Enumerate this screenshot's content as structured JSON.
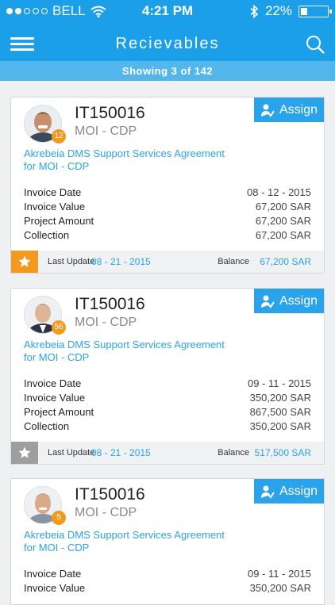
{
  "status_bar": {
    "carrier": "BELL",
    "time": "4:21 PM",
    "battery": "22%"
  },
  "nav": {
    "title": "Recievables"
  },
  "subheader": {
    "showing": "Showing 3 of 142"
  },
  "colors": {
    "primary": "#1a9fe8",
    "accent_orange": "#f39a1e",
    "link_blue": "#2aa3ea"
  },
  "cards": [
    {
      "code": "IT150016",
      "dept": "MOI - CDP",
      "badge": "12",
      "assign": "Assign",
      "description": "Akrebeia DMS Support Services Agreement for MOI - CDP",
      "rows": [
        {
          "label": "Invoice Date",
          "value": "08 - 12 - 2015"
        },
        {
          "label": "Invoice Value",
          "value": "67,200 SAR"
        },
        {
          "label": "Project Amount",
          "value": "67,200 SAR"
        },
        {
          "label": "Collection",
          "value": "67,200 SAR"
        }
      ],
      "last_update_label": "Last Update",
      "last_update": "08 - 21 - 2015",
      "balance_label": "Balance",
      "balance": "67,200 SAR",
      "starred": true
    },
    {
      "code": "IT150016",
      "dept": "MOI - CDP",
      "badge": "56",
      "assign": "Assign",
      "description": "Akrebeia DMS Support Services Agreement for MOI - CDP",
      "rows": [
        {
          "label": "Invoice Date",
          "value": "09 - 11 - 2015"
        },
        {
          "label": "Invoice Value",
          "value": "350,200 SAR"
        },
        {
          "label": "Project Amount",
          "value": "867,500 SAR"
        },
        {
          "label": "Collection",
          "value": "350,200 SAR"
        }
      ],
      "last_update_label": "Last Update",
      "last_update": "08 - 21 - 2015",
      "balance_label": "Balance",
      "balance": "517,500 SAR",
      "starred": false
    },
    {
      "code": "IT150016",
      "dept": "MOI - CDP",
      "badge": "5",
      "assign": "Assign",
      "description": "Akrebeia DMS Support Services Agreement for MOI - CDP",
      "rows": [
        {
          "label": "Invoice Date",
          "value": "09 - 11 - 2015"
        },
        {
          "label": "Invoice Value",
          "value": "350,200 SAR"
        }
      ]
    }
  ]
}
